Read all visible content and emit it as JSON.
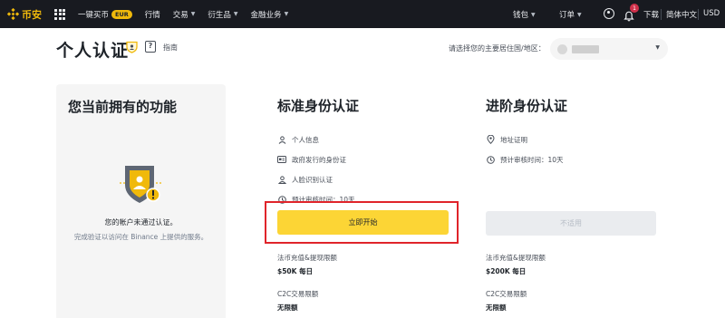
{
  "topbar": {
    "logo_text": "币安",
    "nav": [
      {
        "label": "一键买币",
        "badge": "EUR"
      },
      {
        "label": "行情"
      },
      {
        "label": "交易",
        "caret": true
      },
      {
        "label": "衍生品",
        "caret": true
      },
      {
        "label": "金融业务",
        "caret": true
      }
    ],
    "wallet": "钱包",
    "orders": "订单",
    "notification_count": "1",
    "download": "下载",
    "language": "简体中文",
    "currency": "USD"
  },
  "header": {
    "title": "个人认证",
    "guide": "指南",
    "country_prompt": "请选择您的主要居住国/地区："
  },
  "left_panel": {
    "title": "您当前拥有的功能",
    "status": "您的帐户未通过认证。",
    "hint": "完成验证以访问在 Binance 上提供的服务。"
  },
  "standard": {
    "title": "标准身份认证",
    "requirements": [
      {
        "icon": "person-icon",
        "label": "个人信息"
      },
      {
        "icon": "id-card-icon",
        "label": "政府发行的身份证"
      },
      {
        "icon": "face-icon",
        "label": "人脸识别认证"
      },
      {
        "icon": "clock-icon",
        "label": "预计审核时间：10天"
      }
    ],
    "button": "立即开始",
    "fiat_label": "法币充值&提现限额",
    "fiat_value": "$50K 每日",
    "c2c_label": "C2C交易限额",
    "c2c_value": "无限额"
  },
  "advanced": {
    "title": "进阶身份认证",
    "requirements": [
      {
        "icon": "location-icon",
        "label": "地址证明"
      },
      {
        "icon": "clock-icon",
        "label": "预计审核时间：10天"
      }
    ],
    "button": "不适用",
    "fiat_label": "法币充值&提现限额",
    "fiat_value": "$200K 每日",
    "c2c_label": "C2C交易限额",
    "c2c_value": "无限额"
  },
  "colors": {
    "brand": "#f0b90b",
    "primary_button": "#fcd535",
    "highlight": "#e0242a",
    "topbar": "#181a20"
  }
}
